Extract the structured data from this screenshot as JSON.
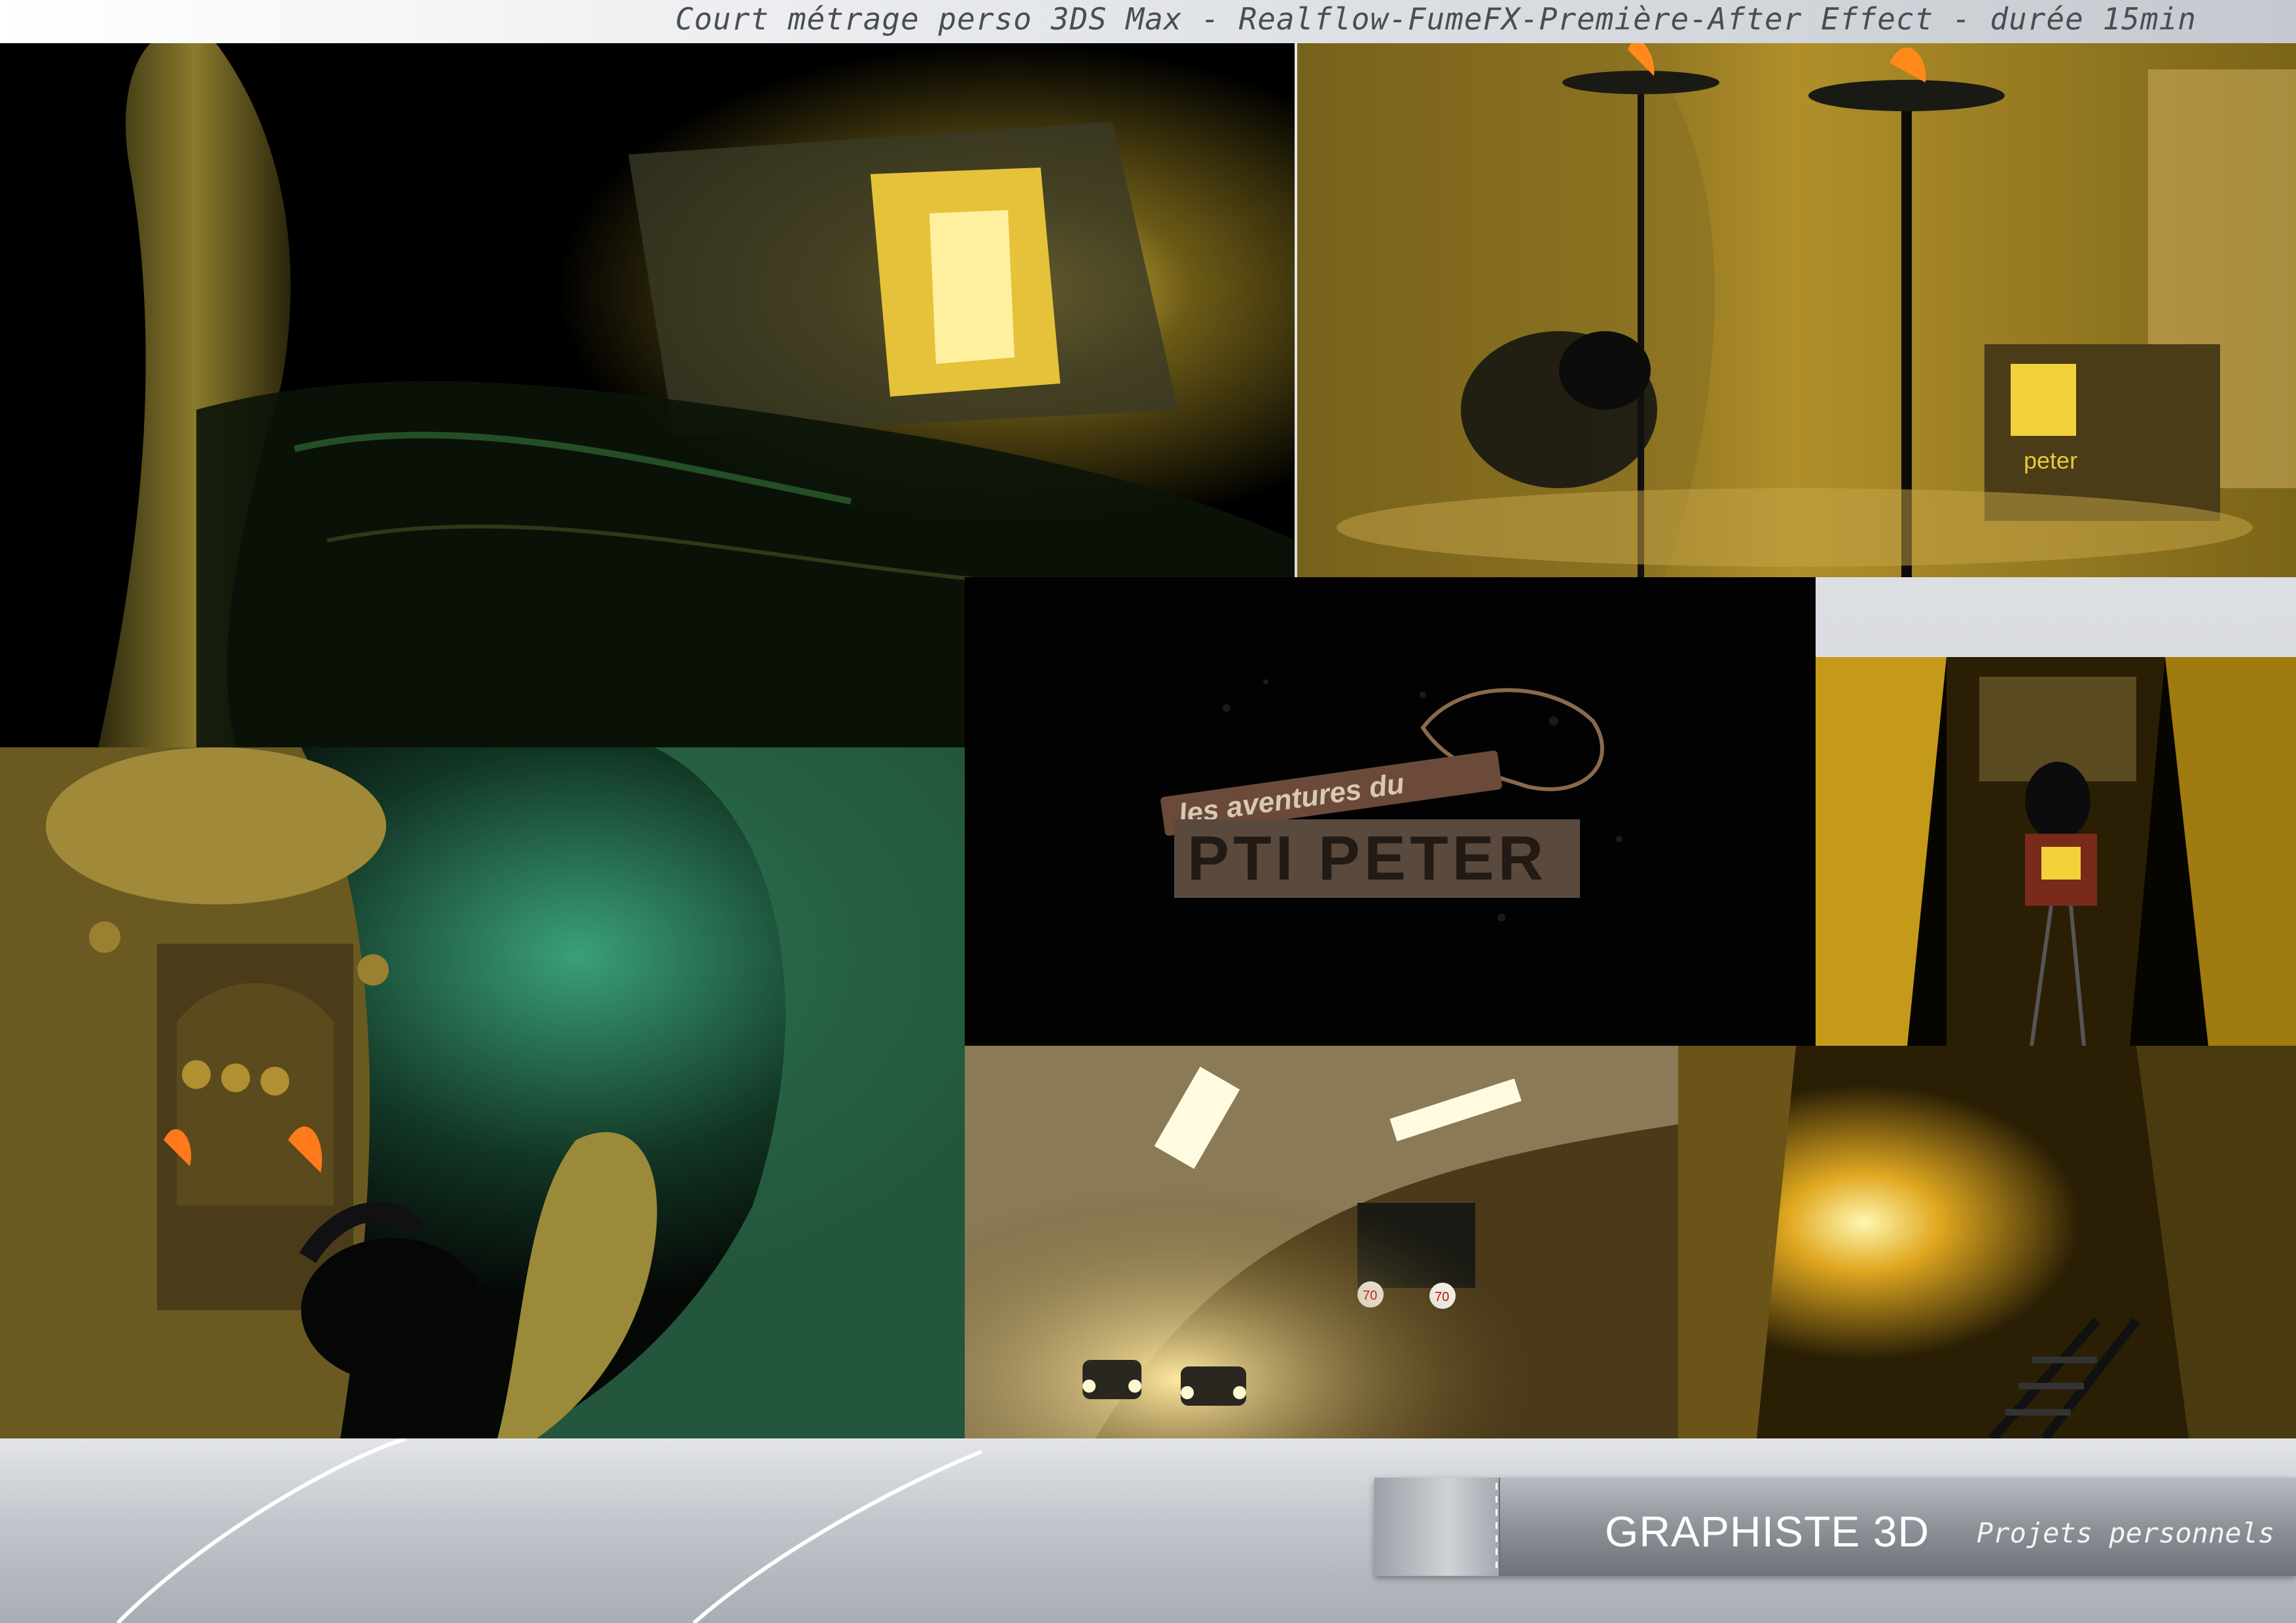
{
  "header": {
    "caption": "Court métrage perso 3DS Max - Realflow-FumeFX-Première-After Effect - durée 15min"
  },
  "gallery": {
    "images": [
      {
        "id": "water-cave",
        "description_icon": "image-icon"
      },
      {
        "id": "torch-corridor",
        "description_icon": "image-icon"
      },
      {
        "id": "title-card",
        "description_icon": "image-icon"
      },
      {
        "id": "mine-cart-tunnel",
        "description_icon": "image-icon"
      },
      {
        "id": "door-cave",
        "description_icon": "image-icon"
      },
      {
        "id": "road-tunnel",
        "description_icon": "image-icon"
      },
      {
        "id": "glowing-mine",
        "description_icon": "image-icon"
      }
    ],
    "title_card": {
      "line1": "les aventures du",
      "line2": "PTI PETER"
    },
    "signs": {
      "speed_left": "70",
      "speed_right": "70"
    },
    "cart_label": "peter"
  },
  "footer": {
    "title": "GRAPHISTE 3D",
    "subtitle": "Projets personnels"
  },
  "colors": {
    "gold": "#c9a23a",
    "dark": "#000000",
    "banner": "#8d9299",
    "caption": "#4a4d53"
  }
}
